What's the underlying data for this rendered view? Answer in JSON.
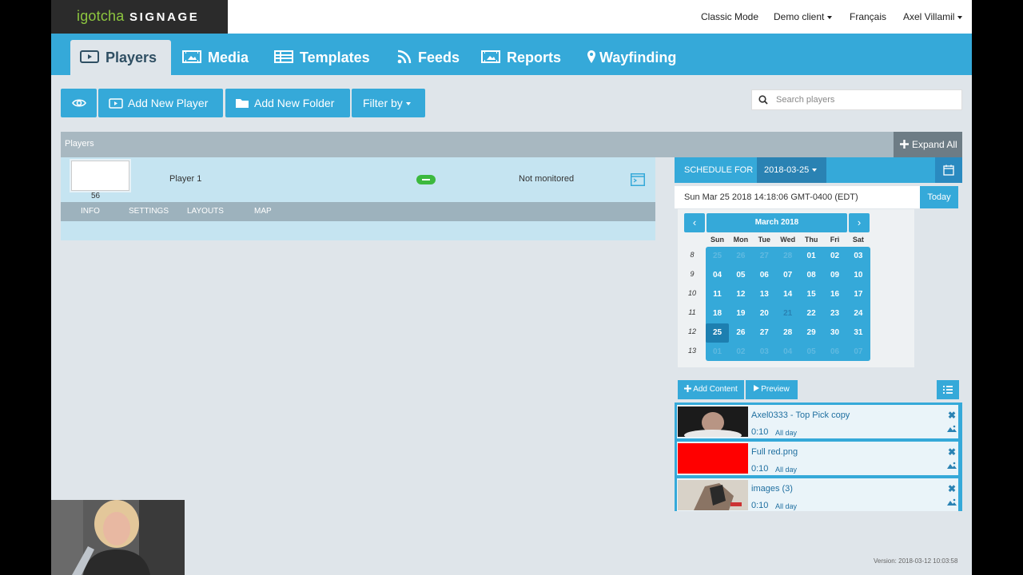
{
  "brand": {
    "name_lower": "igotcha",
    "name_upper": "SIGNAGE"
  },
  "topnav": {
    "classic": "Classic Mode",
    "client": "Demo client",
    "language": "Français",
    "user": "Axel Villamil"
  },
  "mainnav": {
    "tabs": [
      "Players",
      "Media",
      "Templates",
      "Feeds",
      "Reports",
      "Wayfinding"
    ],
    "active": "Players"
  },
  "toolbar": {
    "add_player": "Add New Player",
    "add_folder": "Add New Folder",
    "filter": "Filter by",
    "search_placeholder": "Search players"
  },
  "players": {
    "header": "Players",
    "expand_all": "Expand All",
    "rows": [
      {
        "id": "56",
        "name": "Player 1",
        "monitor": "Not monitored"
      }
    ],
    "tabs": [
      "INFO",
      "SETTINGS",
      "LAYOUTS",
      "MAP"
    ]
  },
  "schedule": {
    "label": "SCHEDULE FOR",
    "date": "2018-03-25",
    "now": "Sun Mar 25 2018 14:18:06 GMT-0400 (EDT)",
    "today_label": "Today",
    "calendar": {
      "prev": "‹",
      "next": "›",
      "month": "March 2018",
      "dow": [
        "Sun",
        "Mon",
        "Tue",
        "Wed",
        "Thu",
        "Fri",
        "Sat"
      ],
      "weeks": [
        "8",
        "9",
        "10",
        "11",
        "12",
        "13"
      ],
      "days": [
        [
          "25",
          "26",
          "27",
          "28",
          "01",
          "02",
          "03"
        ],
        [
          "04",
          "05",
          "06",
          "07",
          "08",
          "09",
          "10"
        ],
        [
          "11",
          "12",
          "13",
          "14",
          "15",
          "16",
          "17"
        ],
        [
          "18",
          "19",
          "20",
          "21",
          "22",
          "23",
          "24"
        ],
        [
          "25",
          "26",
          "27",
          "28",
          "29",
          "30",
          "31"
        ],
        [
          "01",
          "02",
          "03",
          "04",
          "05",
          "06",
          "07"
        ]
      ],
      "selected": "25"
    },
    "add_content": "Add Content",
    "preview": "Preview",
    "items": [
      {
        "name": "Axel0333 - Top Pick copy",
        "duration": "0:10",
        "when": "All day"
      },
      {
        "name": "Full red.png",
        "duration": "0:10",
        "when": "All day"
      },
      {
        "name": "images (3)",
        "duration": "0:10",
        "when": "All day"
      }
    ]
  },
  "footer": {
    "version": "Version: 2018-03-12 10:03:58"
  },
  "colors": {
    "accent": "#35a9d9",
    "dark_accent": "#2a82b3",
    "status_ok": "#3cb93e",
    "logo_green": "#8dc63f"
  }
}
